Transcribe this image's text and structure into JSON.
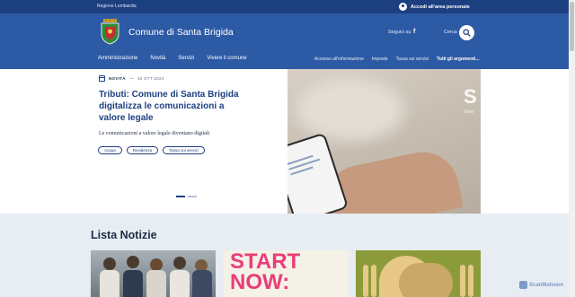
{
  "topbar": {
    "region": "Regione Lombardia",
    "login_label": "Accedi all'area personale"
  },
  "header": {
    "site_title": "Comune di Santa Brigida",
    "follow_label": "Seguici su",
    "social_icon": "f",
    "search_label": "Cerca",
    "nav": [
      "Amministrazione",
      "Novità",
      "Servizi",
      "Vivere il comune"
    ],
    "secondary_nav": [
      "Accesso all'informazione",
      "Imposte",
      "Tassa sui servizi",
      "Tutti gli argomenti..."
    ]
  },
  "hero": {
    "category": "NOVITÀ",
    "separator": "—",
    "date": "10 OTT 2024",
    "title": "Tributi: Comune di Santa Brigida digitalizza le comunicazioni a valore legale",
    "description": "Le comunicazioni a valore legale diventano digitali",
    "chips": [
      "Acqua",
      "Residenza",
      "Tassa sui servizi"
    ],
    "image_brand": "S",
    "image_brand_sub": "Servi"
  },
  "news": {
    "title": "Lista Notizie",
    "card2_text_line1": "START",
    "card2_text_line2": "NOW:"
  },
  "watermark": "ScanMalware",
  "colors": {
    "topbar": "#1c3f80",
    "header": "#2d5aa5",
    "accent": "#1c3f80",
    "news_bg": "#e8edf3",
    "start_pink": "#ea3d7a"
  }
}
